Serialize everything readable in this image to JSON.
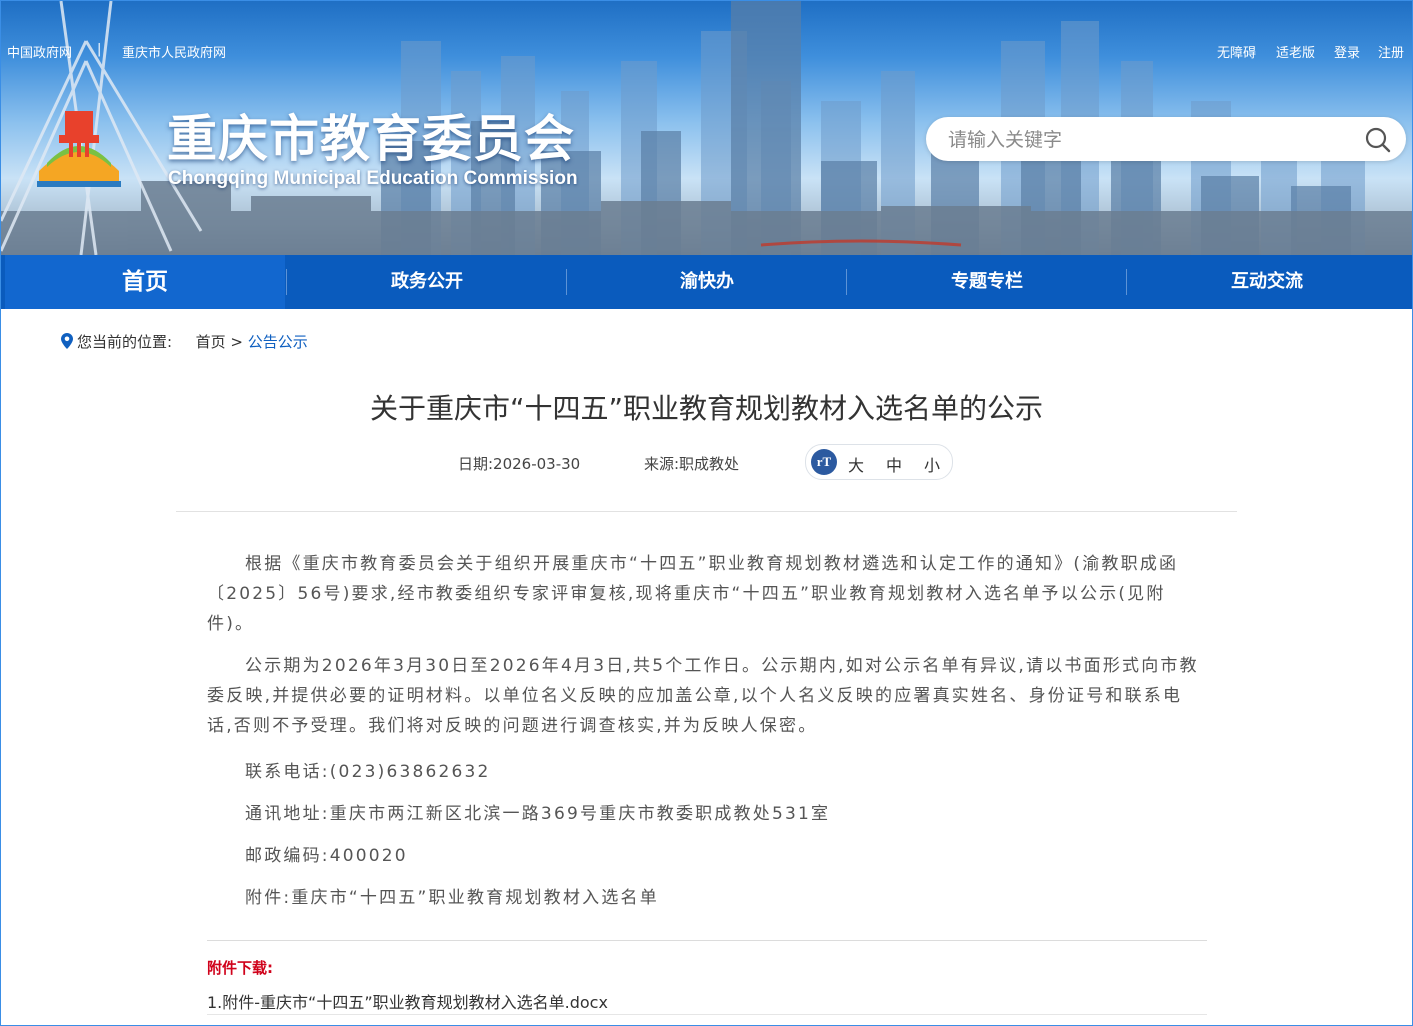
{
  "top_links": {
    "left": [
      "中国政府网",
      "|",
      "重庆市人民政府网"
    ],
    "right": [
      "无障碍",
      "适老版",
      "登录",
      "注册"
    ]
  },
  "site": {
    "title": "重庆市教育委员会",
    "subtitle": "Chongqing Municipal Education Commission"
  },
  "search": {
    "placeholder": "请输入关键字",
    "icon": "search-icon"
  },
  "nav": {
    "items": [
      "首页",
      "政务公开",
      "渝快办",
      "专题专栏",
      "互动交流"
    ],
    "active": "首页"
  },
  "breadcrumb": {
    "label": "您当前的位置:",
    "home": "首页",
    "sep": ">",
    "current": "公告公示"
  },
  "article": {
    "title": "关于重庆市“十四五”职业教育规划教材入选名单的公示",
    "date": "日期:2026-03-30",
    "source": "来源:职成教处",
    "font_sizes": [
      "大",
      "中",
      "小"
    ],
    "para1": "根据《重庆市教育委员会关于组织开展重庆市“十四五”职业教育规划教材遴选和认定工作的通知》(渝教职成函〔2025〕56号)要求,经市教委组织专家评审复核,现将重庆市“十四五”职业教育规划教材入选名单予以公示(见附件)。",
    "para2": "公示期为2026年3月30日至2026年4月3日,共5个工作日。公示期内,如对公示名单有异议,请以书面形式向市教委反映,并提供必要的证明材料。以单位名义反映的应加盖公章,以个人名义反映的应署真实姓名、身份证号和联系电话,否则不予受理。我们将对反映的问题进行调查核实,并为反映人保密。",
    "phone": "联系电话:(023)63862632",
    "address": "通讯地址:重庆市两江新区北滨一路369号重庆市教委职成教处531室",
    "postcode": "邮政编码:400020",
    "attachment_note": "附件:重庆市“十四五”职业教育规划教材入选名单"
  },
  "attachments": {
    "heading": "附件下载:",
    "files": [
      "1.附件-重庆市“十四五”职业教育规划教材入选名单.docx"
    ]
  },
  "colors": {
    "nav_bg": "#0a5bbd",
    "nav_active": "#1267cf",
    "link": "#1060c0",
    "attachment_heading": "#d0021b"
  }
}
